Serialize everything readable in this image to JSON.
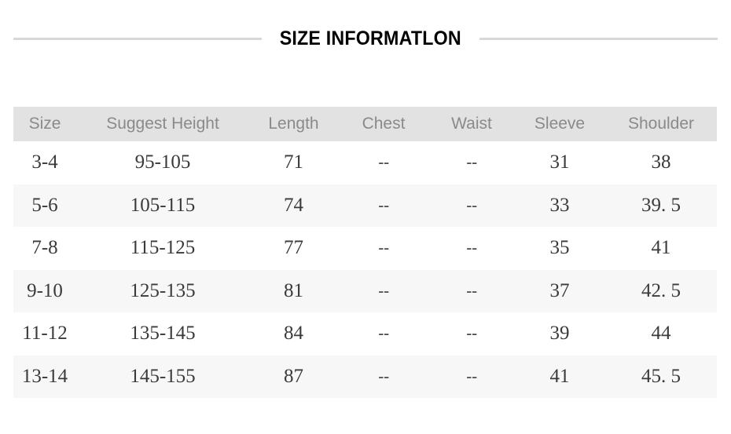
{
  "title": "SIZE INFORMATLON",
  "table": {
    "headers": [
      "Size",
      "Suggest Height",
      "Length",
      "Chest",
      "Waist",
      "Sleeve",
      "Shoulder"
    ],
    "rows": [
      {
        "size": "3-4",
        "suggest_height": "95-105",
        "length": "71",
        "chest": "--",
        "waist": "--",
        "sleeve": "31",
        "shoulder": "38"
      },
      {
        "size": "5-6",
        "suggest_height": "105-115",
        "length": "74",
        "chest": "--",
        "waist": "--",
        "sleeve": "33",
        "shoulder": "39. 5"
      },
      {
        "size": "7-8",
        "suggest_height": "115-125",
        "length": "77",
        "chest": "--",
        "waist": "--",
        "sleeve": "35",
        "shoulder": "41"
      },
      {
        "size": "9-10",
        "suggest_height": "125-135",
        "length": "81",
        "chest": "--",
        "waist": "--",
        "sleeve": "37",
        "shoulder": "42. 5"
      },
      {
        "size": "11-12",
        "suggest_height": "135-145",
        "length": "84",
        "chest": "--",
        "waist": "--",
        "sleeve": "39",
        "shoulder": "44"
      },
      {
        "size": "13-14",
        "suggest_height": "145-155",
        "length": "87",
        "chest": "--",
        "waist": "--",
        "sleeve": "41",
        "shoulder": "45. 5"
      }
    ]
  },
  "colors": {
    "header_band": "#e2e2e2",
    "header_text": "#8a8a8a",
    "row_alt": "#f7f7f7",
    "rule": "#d8d8d8",
    "body_text": "#3a3a3a"
  }
}
